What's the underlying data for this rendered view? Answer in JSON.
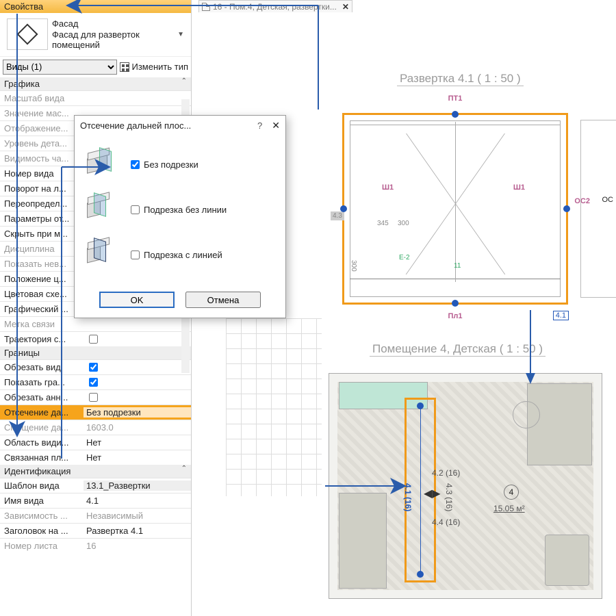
{
  "props": {
    "header": "Свойства",
    "selector": {
      "line1": "Фасад",
      "line2": "Фасад для разверток",
      "line3": "помещений"
    },
    "filter": "Виды (1)",
    "edit_type": "Изменить тип",
    "groups": {
      "graphics": "Графика",
      "bounds": "Границы",
      "ident": "Идентификация"
    },
    "rows": {
      "scale": "Масштаб вида",
      "scaleval": "Значение мас...",
      "display": "Отображение...",
      "detail": "Уровень дета...",
      "visibility": "Видимость ча...",
      "viewnum": "Номер вида",
      "rotation": "Поворот на л...",
      "override": "Переопредел...",
      "params": "Параметры от...",
      "hide": "Скрыть при м...",
      "discipline": "Дисциплина",
      "showhid": "Показать нев...",
      "titlepos": "Положение ц...",
      "colorsch": "Цветовая схе...",
      "graphic": "Графический ...",
      "linklabel": "Метка связи",
      "trajectory": "Траектория с...",
      "cropview": "Обрезать вид",
      "showcrop": "Показать гра...",
      "cropann": "Обрезать анн...",
      "farclip": "Отсечение да...",
      "farclip_val": "Без подрезки",
      "faroff": "Смещение да...",
      "faroff_val": "1603.0",
      "scope": "Область види...",
      "scope_val": "Нет",
      "linked": "Связанная пл...",
      "linked_val": "Нет",
      "template": "Шаблон вида",
      "template_val": "13.1_Развертки",
      "viewname": "Имя вида",
      "viewname_val": "4.1",
      "dep": "Зависимость ...",
      "dep_val": "Независимый",
      "titleon": "Заголовок на ...",
      "titleon_val": "Развертка 4.1",
      "sheetnum": "Номер листа",
      "sheetnum_val": "16"
    }
  },
  "tab": {
    "title": "16 - Пом.4, Детская, развертки..."
  },
  "canvas": {
    "elev_title": "Развертка 4.1 ( 1 : 50 )",
    "plan_title": "Помещение 4, Детская ( 1 : 50 )",
    "labels": {
      "pt1": "ПТ1",
      "pl1": "Пл1",
      "os2": "ОС2",
      "oc": "ОС",
      "sh1a": "Ш1",
      "sh1b": "Ш1",
      "dim345": "345",
      "dim300": "300",
      "dim300b": "300",
      "num41": "4.1",
      "num11": "11",
      "numE2": "E-2",
      "num43": "4.3"
    },
    "plan_labels": {
      "v42": "4.2 (16)",
      "v43": "4.3 (16)",
      "v44": "4.4 (16)",
      "v41": "4.1 (16)",
      "room": "4",
      "area": "15.05 м²"
    }
  },
  "dialog": {
    "title": "Отсечение дальней плос...",
    "opts": {
      "none": "Без подрезки",
      "noline": "Подрезка без линии",
      "withline": "Подрезка с линией"
    },
    "ok": "OK",
    "cancel": "Отмена"
  }
}
